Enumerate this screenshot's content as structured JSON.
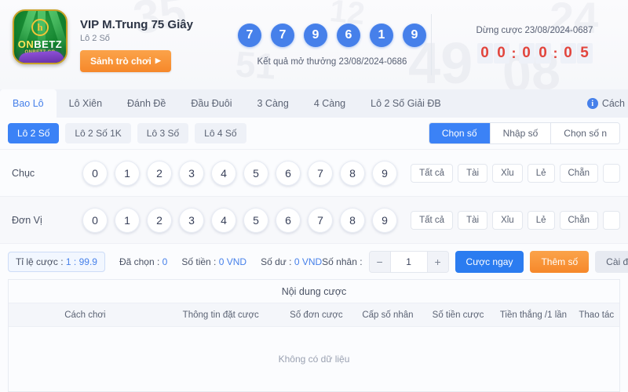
{
  "header": {
    "logo": {
      "name_on": "ON",
      "name_betz": "BETZ",
      "sub": "ONBETZ.CO",
      "emblem": "h",
      "icon": "onbetz-logo-icon"
    },
    "title": "VIP M.Trung 75 Giây",
    "subtitle": "Lô 2 Số",
    "play_button": "Sảnh trò chơi",
    "play_button_icon": "▶",
    "result_balls": [
      "7",
      "7",
      "9",
      "6",
      "1",
      "9"
    ],
    "result_caption": "Kết quả mở thưởng 23/08/2024-0686",
    "countdown_caption": "Dừng cược 23/08/2024-0687",
    "countdown_digits": [
      "0",
      "0",
      "0",
      "0",
      "0",
      "5"
    ],
    "countdown_sep": ":",
    "ball_color": "#4680ea",
    "countdown_color": "#e2453d",
    "watermarks": [
      "35",
      "49",
      "12",
      "24",
      "08",
      "51"
    ]
  },
  "nav": {
    "tabs": [
      {
        "label": "Bao Lô",
        "active": true
      },
      {
        "label": "Lô Xiên",
        "active": false
      },
      {
        "label": "Đánh Đề",
        "active": false
      },
      {
        "label": "Đầu Đuôi",
        "active": false
      },
      {
        "label": "3 Càng",
        "active": false
      },
      {
        "label": "4 Càng",
        "active": false
      },
      {
        "label": "Lô 2 Số Giải ĐB",
        "active": false
      }
    ],
    "help_label": "Cách",
    "help_icon": "info-icon"
  },
  "subbar": {
    "chips": [
      {
        "label": "Lô 2 Số",
        "active": true
      },
      {
        "label": "Lô 2 Số 1K",
        "active": false
      },
      {
        "label": "Lô 3 Số",
        "active": false
      },
      {
        "label": "Lô 4 Số",
        "active": false
      }
    ],
    "modes": [
      {
        "label": "Chọn số",
        "active": true
      },
      {
        "label": "Nhập số",
        "active": false
      },
      {
        "label": "Chọn số n",
        "active": false
      }
    ]
  },
  "rows": [
    {
      "label": "Chục",
      "digits": [
        "0",
        "1",
        "2",
        "3",
        "4",
        "5",
        "6",
        "7",
        "8",
        "9"
      ],
      "quick": [
        "Tất cả",
        "Tài",
        "Xỉu",
        "Lẻ",
        "Chẵn",
        ""
      ]
    },
    {
      "label": "Đơn Vị",
      "digits": [
        "0",
        "1",
        "2",
        "3",
        "4",
        "5",
        "6",
        "7",
        "8",
        "9"
      ],
      "quick": [
        "Tất cả",
        "Tài",
        "Xỉu",
        "Lẻ",
        "Chẵn",
        ""
      ]
    }
  ],
  "betbar": {
    "rate_label": "Tỉ lệ cược :",
    "rate_value": "1 : 99.9",
    "chosen_label": "Đã chọn :",
    "chosen_value": "0",
    "amount_label": "Số tiền :",
    "amount_value": "0 VND",
    "balance_label": "Số dư :",
    "balance_value": "0 VND",
    "multiplier_label": "Số nhân :",
    "multiplier_value": "1",
    "minus": "−",
    "plus": "+",
    "bet_now": "Cược ngay",
    "add_number": "Thêm số",
    "settings": "Cài đặt"
  },
  "table": {
    "title": "Nội dung cược",
    "columns": [
      "Cách chơi",
      "Thông tin đặt cược",
      "Số đơn cược",
      "Cấp số nhân",
      "Số tiền cược",
      "Tiền thắng /1 lần",
      "Thao tác"
    ],
    "empty_text": "Không có dữ liệu"
  }
}
